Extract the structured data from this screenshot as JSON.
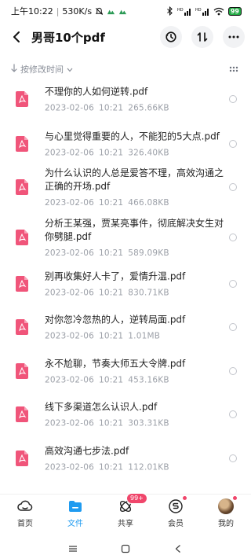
{
  "status_bar": {
    "time": "上午10:22",
    "speed": "530K/s",
    "battery": "99"
  },
  "header": {
    "title": "男哥10个pdf"
  },
  "sort": {
    "label": "按修改时间"
  },
  "files": [
    {
      "name": "不理你的人如何逆转.pdf",
      "date": "2023-02-06",
      "time": "10:21",
      "size": "265.66KB"
    },
    {
      "name": "与心里觉得重要的人，不能犯的5大点.pdf",
      "date": "2023-02-06",
      "time": "10:21",
      "size": "326.40KB"
    },
    {
      "name": "为什么认识的人总是爱答不理，高效沟通之正确的开场.pdf",
      "date": "2023-02-06",
      "time": "10:21",
      "size": "466.08KB"
    },
    {
      "name": "分析王某强，贾某亮事件，彻底解决女生对你劈腿.pdf",
      "date": "2023-02-06",
      "time": "10:21",
      "size": "589.09KB"
    },
    {
      "name": "别再收集好人卡了，爱情升温.pdf",
      "date": "2023-02-06",
      "time": "10:21",
      "size": "830.71KB"
    },
    {
      "name": "对你忽冷忽热的人，逆转局面.pdf",
      "date": "2023-02-06",
      "time": "10:21",
      "size": "1.01MB"
    },
    {
      "name": "永不尬聊，节奏大师五大令牌.pdf",
      "date": "2023-02-06",
      "time": "10:21",
      "size": "453.16KB"
    },
    {
      "name": "线下多渠道怎么认识人.pdf",
      "date": "2023-02-06",
      "time": "10:21",
      "size": "303.31KB"
    },
    {
      "name": "高效沟通七步法.pdf",
      "date": "2023-02-06",
      "time": "10:21",
      "size": "112.01KB"
    }
  ],
  "bottom_nav": {
    "home": "首页",
    "files": "文件",
    "share": "共享",
    "share_badge": "99+",
    "member": "会员",
    "mine": "我的"
  },
  "colors": {
    "accent": "#1f9bf0",
    "pdf": "#f0557a",
    "badge": "#f0466b"
  }
}
